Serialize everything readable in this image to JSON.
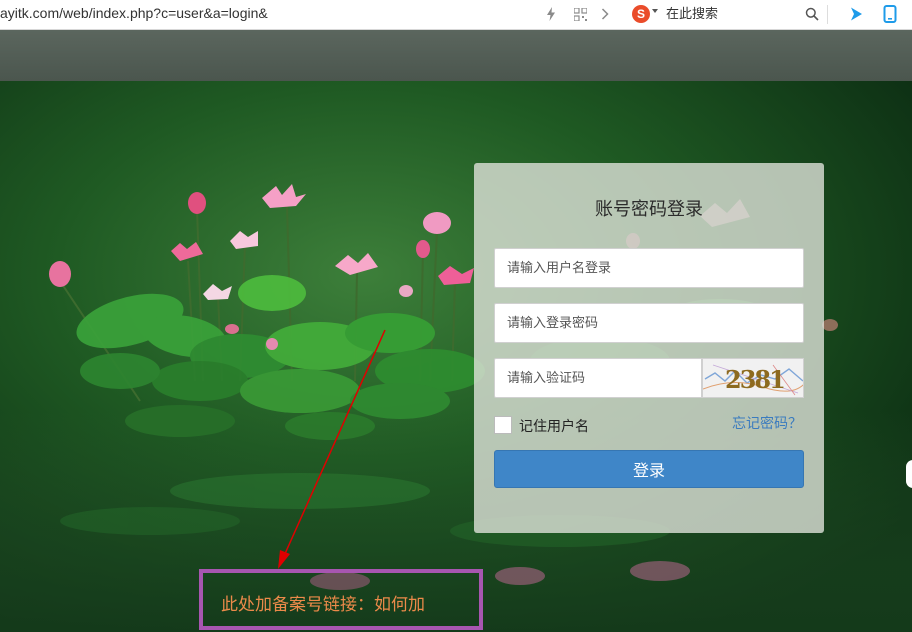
{
  "browser": {
    "url": "ayitk.com/web/index.php?c=user&a=login&",
    "search_placeholder": "在此搜索",
    "search_engine_glyph": "S",
    "icons": [
      "lightning-icon",
      "qr-code-icon",
      "chevron-right-icon",
      "search-engine-logo",
      "search-icon",
      "play-icon",
      "phone-icon"
    ]
  },
  "login": {
    "title": "账号密码登录",
    "username_placeholder": "请输入用户名登录",
    "password_placeholder": "请输入登录密码",
    "captcha_placeholder": "请输入验证码",
    "captcha_text": "2381",
    "remember_label": "记住用户名",
    "forgot_link": "忘记密码？",
    "submit_label": "登录"
  },
  "annotation": {
    "text": "此处加备案号链接：如何加"
  },
  "colors": {
    "header_strip": "#556058",
    "login_button": "#3f86c8",
    "forgot_link": "#3a7bbf",
    "annotation_border": "#a756b0",
    "annotation_text": "#ec8a4a",
    "arrow": "#e00000"
  }
}
